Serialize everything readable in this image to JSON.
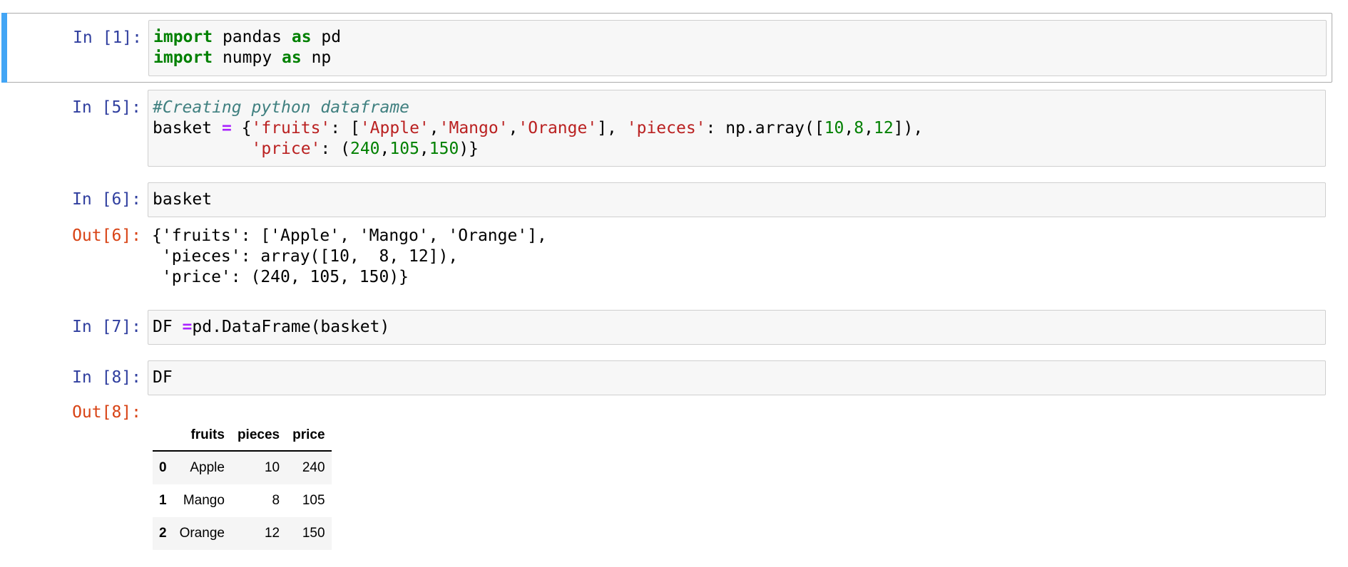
{
  "notebook": {
    "cells": [
      {
        "prompt": "In [1]:",
        "lines": [
          [
            {
              "t": "import",
              "c": "kw"
            },
            {
              "t": " pandas ",
              "c": ""
            },
            {
              "t": "as",
              "c": "kw"
            },
            {
              "t": " pd",
              "c": ""
            }
          ],
          [
            {
              "t": "import",
              "c": "kw"
            },
            {
              "t": " numpy ",
              "c": ""
            },
            {
              "t": "as",
              "c": "kw"
            },
            {
              "t": " np",
              "c": ""
            }
          ]
        ]
      },
      {
        "prompt": "In [5]:",
        "lines": [
          [
            {
              "t": "#Creating python dataframe",
              "c": "cmt"
            }
          ],
          [
            {
              "t": "basket ",
              "c": ""
            },
            {
              "t": "=",
              "c": "op"
            },
            {
              "t": " {",
              "c": ""
            },
            {
              "t": "'fruits'",
              "c": "str"
            },
            {
              "t": ": [",
              "c": ""
            },
            {
              "t": "'Apple'",
              "c": "str"
            },
            {
              "t": ",",
              "c": ""
            },
            {
              "t": "'Mango'",
              "c": "str"
            },
            {
              "t": ",",
              "c": ""
            },
            {
              "t": "'Orange'",
              "c": "str"
            },
            {
              "t": "], ",
              "c": ""
            },
            {
              "t": "'pieces'",
              "c": "str"
            },
            {
              "t": ": np.array([",
              "c": ""
            },
            {
              "t": "10",
              "c": "num"
            },
            {
              "t": ",",
              "c": ""
            },
            {
              "t": "8",
              "c": "num"
            },
            {
              "t": ",",
              "c": ""
            },
            {
              "t": "12",
              "c": "num"
            },
            {
              "t": "]),",
              "c": ""
            }
          ],
          [
            {
              "t": "          ",
              "c": ""
            },
            {
              "t": "'price'",
              "c": "str"
            },
            {
              "t": ": (",
              "c": ""
            },
            {
              "t": "240",
              "c": "num"
            },
            {
              "t": ",",
              "c": ""
            },
            {
              "t": "105",
              "c": "num"
            },
            {
              "t": ",",
              "c": ""
            },
            {
              "t": "150",
              "c": "num"
            },
            {
              "t": ")}",
              "c": ""
            }
          ]
        ]
      },
      {
        "prompt": "In [6]:",
        "lines": [
          [
            {
              "t": "basket",
              "c": ""
            }
          ]
        ],
        "out_prompt": "Out[6]:",
        "output": "{'fruits': ['Apple', 'Mango', 'Orange'],\n 'pieces': array([10,  8, 12]),\n 'price': (240, 105, 150)}"
      },
      {
        "prompt": "In [7]:",
        "lines": [
          [
            {
              "t": "DF ",
              "c": ""
            },
            {
              "t": "=",
              "c": "op"
            },
            {
              "t": "pd.DataFrame(basket)",
              "c": ""
            }
          ]
        ]
      },
      {
        "prompt": "In [8]:",
        "lines": [
          [
            {
              "t": "DF",
              "c": ""
            }
          ]
        ],
        "out_prompt": "Out[8]:",
        "table": {
          "columns": [
            "",
            "fruits",
            "pieces",
            "price"
          ],
          "rows": [
            [
              "0",
              "Apple",
              "10",
              "240"
            ],
            [
              "1",
              "Mango",
              "8",
              "105"
            ],
            [
              "2",
              "Orange",
              "12",
              "150"
            ]
          ]
        }
      }
    ]
  }
}
